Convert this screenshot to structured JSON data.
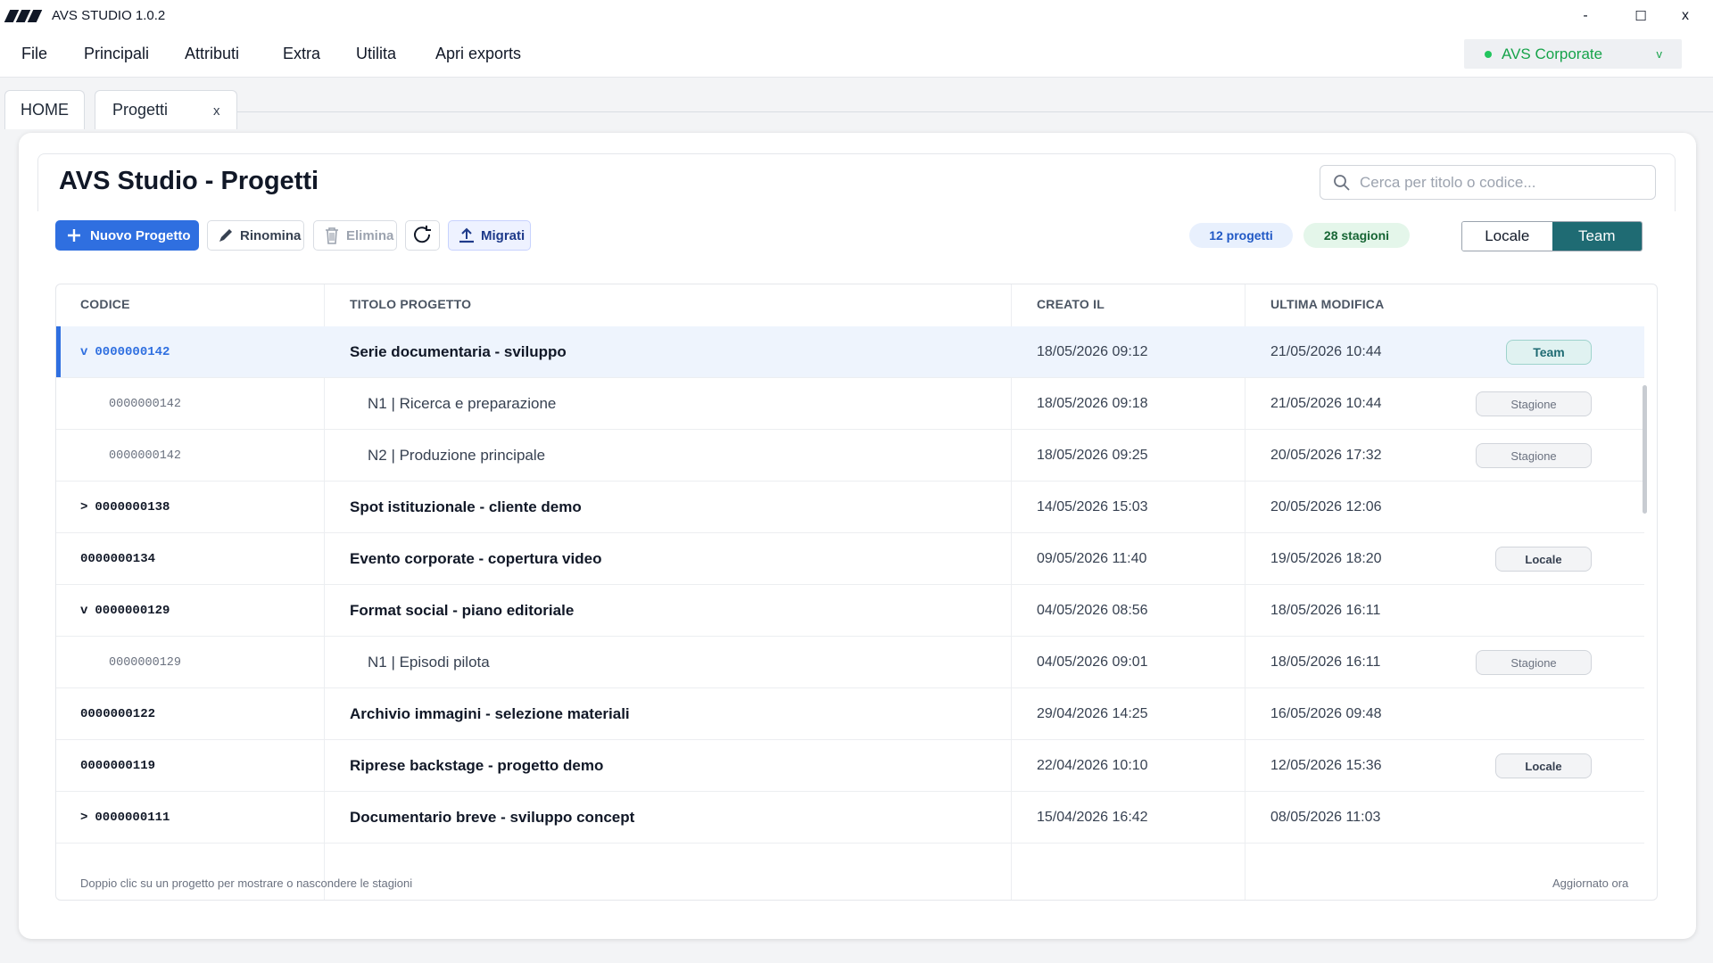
{
  "window": {
    "title": "AVS STUDIO 1.0.2",
    "minimize": "-",
    "maximize": "☐",
    "close": "x"
  },
  "menu": [
    "File",
    "Principali",
    "Attributi",
    "Extra",
    "Utilita",
    "Apri exports"
  ],
  "account": {
    "name": "AVS Corporate",
    "chevron": "v",
    "status_color": "#22c55e"
  },
  "tabs": [
    {
      "label": "HOME"
    },
    {
      "label": "Progetti",
      "close": "x"
    }
  ],
  "page": {
    "title": "AVS Studio - Progetti",
    "search_placeholder": "Cerca per titolo o codice..."
  },
  "toolbar": {
    "new_label": "Nuovo Progetto",
    "rename_label": "Rinomina",
    "delete_label": "Elimina",
    "migrated_label": "Migrati",
    "projects_count": "12 progetti",
    "seasons_count": "28 stagioni",
    "view_local": "Locale",
    "view_team": "Team"
  },
  "table": {
    "headers": [
      "CODICE",
      "TITOLO PROGETTO",
      "CREATO IL",
      "ULTIMA MODIFICA"
    ],
    "rows": [
      {
        "toggle": "v",
        "code": "0000000142",
        "title": "Serie documentaria - sviluppo",
        "created": "18/05/2026 09:12",
        "modified": "21/05/2026 10:44",
        "badge": "Team"
      },
      {
        "toggle": "",
        "code": "0000000142",
        "title": "N1 | Ricerca e preparazione",
        "created": "18/05/2026 09:18",
        "modified": "21/05/2026 10:44",
        "badge": "Stagione"
      },
      {
        "toggle": "",
        "code": "0000000142",
        "title": "N2 | Produzione principale",
        "created": "18/05/2026 09:25",
        "modified": "20/05/2026 17:32",
        "badge": "Stagione"
      },
      {
        "toggle": ">",
        "code": "0000000138",
        "title": "Spot istituzionale - cliente demo",
        "created": "14/05/2026 15:03",
        "modified": "20/05/2026 12:06",
        "badge": ""
      },
      {
        "toggle": "",
        "code": "0000000134",
        "title": "Evento corporate - copertura video",
        "created": "09/05/2026 11:40",
        "modified": "19/05/2026 18:20",
        "badge": "Locale"
      },
      {
        "toggle": "v",
        "code": "0000000129",
        "title": "Format social - piano editoriale",
        "created": "04/05/2026 08:56",
        "modified": "18/05/2026 16:11",
        "badge": ""
      },
      {
        "toggle": "",
        "code": "0000000129",
        "title": "N1 | Episodi pilota",
        "created": "04/05/2026 09:01",
        "modified": "18/05/2026 16:11",
        "badge": "Stagione"
      },
      {
        "toggle": "",
        "code": "0000000122",
        "title": "Archivio immagini - selezione materiali",
        "created": "29/04/2026 14:25",
        "modified": "16/05/2026 09:48",
        "badge": ""
      },
      {
        "toggle": "",
        "code": "0000000119",
        "title": "Riprese backstage - progetto demo",
        "created": "22/04/2026 10:10",
        "modified": "12/05/2026 15:36",
        "badge": "Locale"
      },
      {
        "toggle": ">",
        "code": "0000000111",
        "title": "Documentario breve - sviluppo concept",
        "created": "15/04/2026 16:42",
        "modified": "08/05/2026 11:03",
        "badge": ""
      }
    ]
  },
  "footer": {
    "hint": "Doppio clic su un progetto per mostrare o nascondere le stagioni",
    "status": "Aggiornato ora"
  },
  "colors": {
    "primary": "#2f6fe0",
    "team": "#1f6b73",
    "accent_green": "#16a34a"
  }
}
